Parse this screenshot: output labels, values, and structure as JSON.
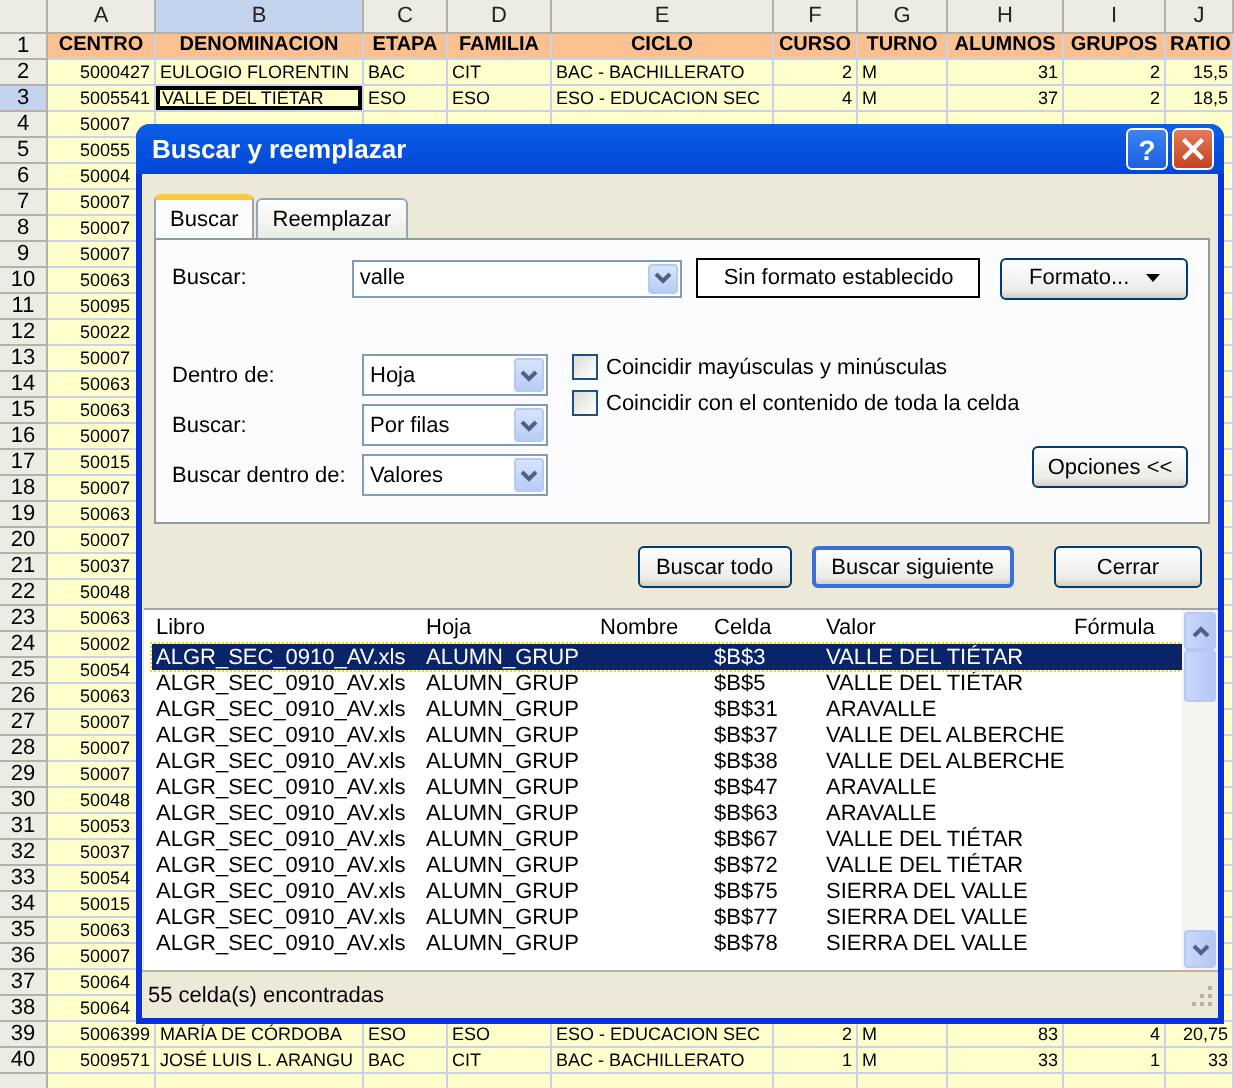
{
  "spreadsheet": {
    "columns": [
      {
        "label": "A",
        "kind": "number",
        "selected": false
      },
      {
        "label": "B",
        "kind": "text",
        "selected": true
      },
      {
        "label": "C",
        "kind": "text",
        "selected": false
      },
      {
        "label": "D",
        "kind": "text",
        "selected": false
      },
      {
        "label": "E",
        "kind": "text",
        "selected": false
      },
      {
        "label": "F",
        "kind": "number",
        "selected": false
      },
      {
        "label": "G",
        "kind": "text",
        "selected": false
      },
      {
        "label": "H",
        "kind": "number",
        "selected": false
      },
      {
        "label": "I",
        "kind": "number",
        "selected": false
      },
      {
        "label": "J",
        "kind": "number",
        "selected": false
      }
    ],
    "rows": [
      {
        "number": "1",
        "kind": "header",
        "selected": false,
        "cells": [
          "CENTRO",
          "DENOMINACION",
          "ETAPA",
          "FAMILIA",
          "CICLO",
          "CURSO",
          "TURNO",
          "ALUMNOS",
          "GRUPOS",
          "RATIO"
        ]
      },
      {
        "number": "2",
        "kind": "data",
        "selected": false,
        "cells": [
          "5000427",
          "EULOGIO FLORENTIN",
          "BAC",
          "CIT",
          "BAC - BACHILLERATO",
          "2",
          "M",
          "31",
          "2",
          "15,5"
        ]
      },
      {
        "number": "3",
        "kind": "data",
        "selected": true,
        "cells": [
          "5005541",
          "VALLE DEL TIÉTAR",
          "ESO",
          "ESO",
          "ESO - EDUCACION SEC",
          "4",
          "M",
          "37",
          "2",
          "18,5"
        ]
      },
      {
        "number": "4",
        "kind": "partial",
        "selected": false,
        "cells": [
          "50007"
        ]
      },
      {
        "number": "5",
        "kind": "partial",
        "selected": false,
        "cells": [
          "50055"
        ]
      },
      {
        "number": "6",
        "kind": "partial",
        "selected": false,
        "cells": [
          "50004"
        ]
      },
      {
        "number": "7",
        "kind": "partial",
        "selected": false,
        "cells": [
          "50007"
        ]
      },
      {
        "number": "8",
        "kind": "partial",
        "selected": false,
        "cells": [
          "50007"
        ]
      },
      {
        "number": "9",
        "kind": "partial",
        "selected": false,
        "cells": [
          "50007"
        ]
      },
      {
        "number": "10",
        "kind": "partial",
        "selected": false,
        "cells": [
          "50063"
        ]
      },
      {
        "number": "11",
        "kind": "partial",
        "selected": false,
        "cells": [
          "50095"
        ]
      },
      {
        "number": "12",
        "kind": "partial",
        "selected": false,
        "cells": [
          "50022"
        ]
      },
      {
        "number": "13",
        "kind": "partial",
        "selected": false,
        "cells": [
          "50007"
        ]
      },
      {
        "number": "14",
        "kind": "partial",
        "selected": false,
        "cells": [
          "50063"
        ]
      },
      {
        "number": "15",
        "kind": "partial",
        "selected": false,
        "cells": [
          "50063"
        ]
      },
      {
        "number": "16",
        "kind": "partial",
        "selected": false,
        "cells": [
          "50007"
        ]
      },
      {
        "number": "17",
        "kind": "partial",
        "selected": false,
        "cells": [
          "50015"
        ]
      },
      {
        "number": "18",
        "kind": "partial",
        "selected": false,
        "cells": [
          "50007"
        ]
      },
      {
        "number": "19",
        "kind": "partial",
        "selected": false,
        "cells": [
          "50063"
        ]
      },
      {
        "number": "20",
        "kind": "partial",
        "selected": false,
        "cells": [
          "50007"
        ]
      },
      {
        "number": "21",
        "kind": "partial",
        "selected": false,
        "cells": [
          "50037"
        ]
      },
      {
        "number": "22",
        "kind": "partial",
        "selected": false,
        "cells": [
          "50048"
        ]
      },
      {
        "number": "23",
        "kind": "partial",
        "selected": false,
        "cells": [
          "50063"
        ]
      },
      {
        "number": "24",
        "kind": "partial",
        "selected": false,
        "cells": [
          "50002"
        ]
      },
      {
        "number": "25",
        "kind": "partial",
        "selected": false,
        "cells": [
          "50054"
        ]
      },
      {
        "number": "26",
        "kind": "partial",
        "selected": false,
        "cells": [
          "50063"
        ]
      },
      {
        "number": "27",
        "kind": "partial",
        "selected": false,
        "cells": [
          "50007"
        ]
      },
      {
        "number": "28",
        "kind": "partial",
        "selected": false,
        "cells": [
          "50007"
        ]
      },
      {
        "number": "29",
        "kind": "partial",
        "selected": false,
        "cells": [
          "50007"
        ]
      },
      {
        "number": "30",
        "kind": "partial",
        "selected": false,
        "cells": [
          "50048"
        ]
      },
      {
        "number": "31",
        "kind": "partial",
        "selected": false,
        "cells": [
          "50053"
        ]
      },
      {
        "number": "32",
        "kind": "partial",
        "selected": false,
        "cells": [
          "50037"
        ]
      },
      {
        "number": "33",
        "kind": "partial",
        "selected": false,
        "cells": [
          "50054"
        ]
      },
      {
        "number": "34",
        "kind": "partial",
        "selected": false,
        "cells": [
          "50015"
        ]
      },
      {
        "number": "35",
        "kind": "partial",
        "selected": false,
        "cells": [
          "50063"
        ]
      },
      {
        "number": "36",
        "kind": "partial",
        "selected": false,
        "cells": [
          "50007"
        ]
      },
      {
        "number": "37",
        "kind": "partial",
        "selected": false,
        "cells": [
          "50064"
        ]
      },
      {
        "number": "38",
        "kind": "partial",
        "selected": false,
        "cells": [
          "50064"
        ]
      },
      {
        "number": "39",
        "kind": "data",
        "selected": false,
        "cells": [
          "5006399",
          "MARÍA DE CÓRDOBA",
          "ESO",
          "ESO",
          "ESO - EDUCACION SEC",
          "2",
          "M",
          "83",
          "4",
          "20,75"
        ]
      },
      {
        "number": "40",
        "kind": "data",
        "selected": false,
        "cells": [
          "5009571",
          "JOSÉ LUIS L. ARANGU",
          "BAC",
          "CIT",
          "BAC - BACHILLERATO",
          "1",
          "M",
          "33",
          "1",
          "33"
        ]
      }
    ]
  },
  "dialog": {
    "title": "Buscar y reemplazar",
    "help_button": "?",
    "tabs": [
      {
        "label": "Buscar",
        "selected": true
      },
      {
        "label": "Reemplazar",
        "selected": false
      }
    ],
    "find_what": {
      "label": "Buscar:",
      "value": "valle"
    },
    "format_preview": "Sin formato establecido",
    "format_button": "Formato...",
    "dropdowns": [
      {
        "label": "Dentro de:",
        "value": "Hoja"
      },
      {
        "label": "Buscar:",
        "value": "Por filas"
      },
      {
        "label": "Buscar dentro de:",
        "value": "Valores"
      }
    ],
    "checkboxes": [
      {
        "label": "Coincidir mayúsculas y minúsculas",
        "checked": false
      },
      {
        "label": "Coincidir con el contenido de toda la celda",
        "checked": false
      }
    ],
    "options_button": "Opciones <<",
    "buttons": [
      {
        "label": "Buscar todo",
        "default": false
      },
      {
        "label": "Buscar siguiente",
        "default": true
      },
      {
        "label": "Cerrar",
        "default": false
      }
    ],
    "results": {
      "columns": [
        "Libro",
        "Hoja",
        "Nombre",
        "Celda",
        "Valor",
        "Fórmula"
      ],
      "rows": [
        {
          "book": "ALGR_SEC_0910_AV.xls",
          "sheet": "ALUMN_GRUP",
          "cell": "$B$3",
          "value": "VALLE DEL TIÉTAR",
          "selected": true
        },
        {
          "book": "ALGR_SEC_0910_AV.xls",
          "sheet": "ALUMN_GRUP",
          "cell": "$B$5",
          "value": "VALLE DEL TIÉTAR",
          "selected": false
        },
        {
          "book": "ALGR_SEC_0910_AV.xls",
          "sheet": "ALUMN_GRUP",
          "cell": "$B$31",
          "value": "ARAVALLE",
          "selected": false
        },
        {
          "book": "ALGR_SEC_0910_AV.xls",
          "sheet": "ALUMN_GRUP",
          "cell": "$B$37",
          "value": "VALLE DEL ALBERCHE",
          "selected": false
        },
        {
          "book": "ALGR_SEC_0910_AV.xls",
          "sheet": "ALUMN_GRUP",
          "cell": "$B$38",
          "value": "VALLE DEL ALBERCHE",
          "selected": false
        },
        {
          "book": "ALGR_SEC_0910_AV.xls",
          "sheet": "ALUMN_GRUP",
          "cell": "$B$47",
          "value": "ARAVALLE",
          "selected": false
        },
        {
          "book": "ALGR_SEC_0910_AV.xls",
          "sheet": "ALUMN_GRUP",
          "cell": "$B$63",
          "value": "ARAVALLE",
          "selected": false
        },
        {
          "book": "ALGR_SEC_0910_AV.xls",
          "sheet": "ALUMN_GRUP",
          "cell": "$B$67",
          "value": "VALLE DEL TIÉTAR",
          "selected": false
        },
        {
          "book": "ALGR_SEC_0910_AV.xls",
          "sheet": "ALUMN_GRUP",
          "cell": "$B$72",
          "value": "VALLE DEL TIÉTAR",
          "selected": false
        },
        {
          "book": "ALGR_SEC_0910_AV.xls",
          "sheet": "ALUMN_GRUP",
          "cell": "$B$75",
          "value": "SIERRA DEL VALLE",
          "selected": false
        },
        {
          "book": "ALGR_SEC_0910_AV.xls",
          "sheet": "ALUMN_GRUP",
          "cell": "$B$77",
          "value": "SIERRA DEL VALLE",
          "selected": false
        },
        {
          "book": "ALGR_SEC_0910_AV.xls",
          "sheet": "ALUMN_GRUP",
          "cell": "$B$78",
          "value": "SIERRA DEL VALLE",
          "selected": false
        }
      ]
    },
    "status": "55 celda(s) encontradas"
  }
}
